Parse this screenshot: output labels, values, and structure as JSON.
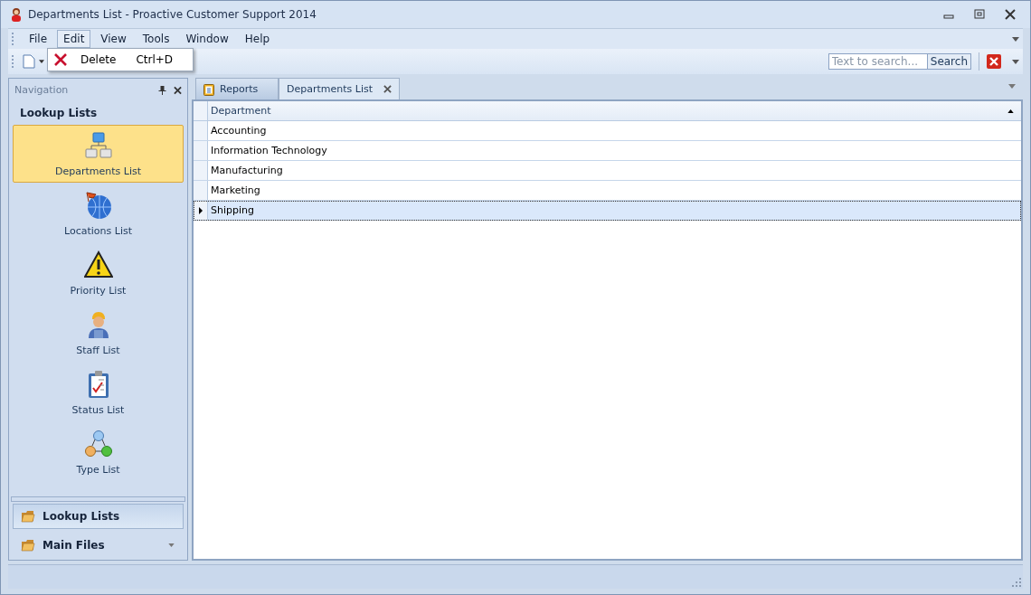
{
  "window": {
    "title": "Departments List - Proactive Customer Support 2014"
  },
  "menu": [
    {
      "label": "File",
      "open": false
    },
    {
      "label": "Edit",
      "open": true
    },
    {
      "label": "View",
      "open": false
    },
    {
      "label": "Tools",
      "open": false
    },
    {
      "label": "Window",
      "open": false
    },
    {
      "label": "Help",
      "open": false
    }
  ],
  "dropdown": [
    {
      "label": "Delete",
      "shortcut": "Ctrl+D"
    }
  ],
  "search": {
    "placeholder": "Text to search...",
    "button": "Search"
  },
  "navigation": {
    "title": "Navigation",
    "heading": "Lookup Lists",
    "items": [
      {
        "label": "Departments List",
        "kind": "org",
        "selected": true
      },
      {
        "label": "Locations List",
        "kind": "globe",
        "selected": false
      },
      {
        "label": "Priority List",
        "kind": "warning",
        "selected": false
      },
      {
        "label": "Staff List",
        "kind": "worker",
        "selected": false
      },
      {
        "label": "Status List",
        "kind": "clipboard",
        "selected": false
      },
      {
        "label": "Type List",
        "kind": "cycle",
        "selected": false
      }
    ],
    "groups": [
      {
        "label": "Lookup Lists",
        "selected": true
      },
      {
        "label": "Main Files",
        "selected": false
      }
    ]
  },
  "tabs": [
    {
      "label": "Reports",
      "selected": false,
      "closable": false
    },
    {
      "label": "Departments List",
      "selected": true,
      "closable": true
    }
  ],
  "table": {
    "columns": [
      "Department"
    ],
    "rows": [
      {
        "cells": [
          "Accounting"
        ],
        "selected": false
      },
      {
        "cells": [
          "Information Technology"
        ],
        "selected": false
      },
      {
        "cells": [
          "Manufacturing"
        ],
        "selected": false
      },
      {
        "cells": [
          "Marketing"
        ],
        "selected": false
      },
      {
        "cells": [
          "Shipping"
        ],
        "selected": true
      }
    ]
  }
}
